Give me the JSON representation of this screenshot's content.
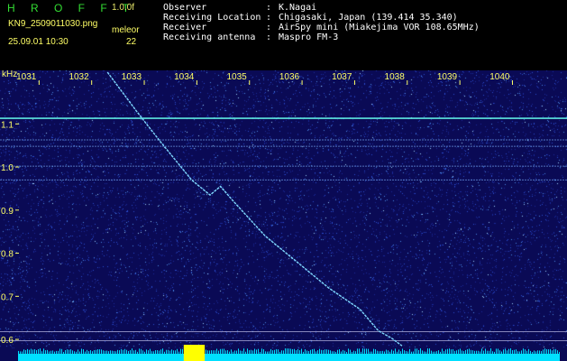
{
  "header": {
    "brand": "H R O F F T",
    "version": "1.0.0f",
    "filename": "KN9_2509011030.png",
    "tag": "meleor",
    "datetime": "25.09.01 10:30",
    "count": "22",
    "info": [
      {
        "key": "Observer",
        "value": "K.Nagai"
      },
      {
        "key": "Receiving Location",
        "value": "Chigasaki, Japan (139.414 35.340)"
      },
      {
        "key": "Receiver",
        "value": "AirSpy mini (Miakejima VOR 108.65MHz)"
      },
      {
        "key": "Receiving antenna",
        "value": "Maspro FM-3"
      }
    ]
  },
  "colors": {
    "background": "#0a0a55",
    "axis_text": "#ffff66",
    "trail": "#7fd8ff",
    "carrier": "#66ffee",
    "noise_floor": "#00e0ff",
    "burst": "#ffff00"
  },
  "spectrogram": {
    "y_unit": "kHz",
    "y_ticks": [
      "1.1",
      "1.0",
      "0.9",
      "0.8",
      "0.7",
      "0.6"
    ],
    "x_ticks": [
      "1031",
      "1032",
      "1033",
      "1034",
      "1035",
      "1036",
      "1037",
      "1038",
      "1039",
      "1040"
    ],
    "x_range_s": [
      1030.6,
      1040.9
    ],
    "y_range_khz": [
      0.575,
      1.22
    ],
    "carrier_lines_khz": [
      1.113,
      1.063,
      1.048,
      1.002,
      0.97,
      0.618,
      0.597
    ],
    "meteor_trail": [
      {
        "t": 1032.3,
        "f": 1.22
      },
      {
        "t": 1032.85,
        "f": 1.13
      },
      {
        "t": 1033.3,
        "f": 1.06
      },
      {
        "t": 1033.9,
        "f": 0.97
      },
      {
        "t": 1034.25,
        "f": 0.935
      },
      {
        "t": 1034.45,
        "f": 0.955
      },
      {
        "t": 1034.7,
        "f": 0.92
      },
      {
        "t": 1035.3,
        "f": 0.84
      },
      {
        "t": 1035.9,
        "f": 0.78
      },
      {
        "t": 1036.5,
        "f": 0.72
      },
      {
        "t": 1037.1,
        "f": 0.67
      },
      {
        "t": 1037.45,
        "f": 0.62
      },
      {
        "t": 1037.7,
        "f": 0.603
      },
      {
        "t": 1037.9,
        "f": 0.585
      }
    ]
  }
}
